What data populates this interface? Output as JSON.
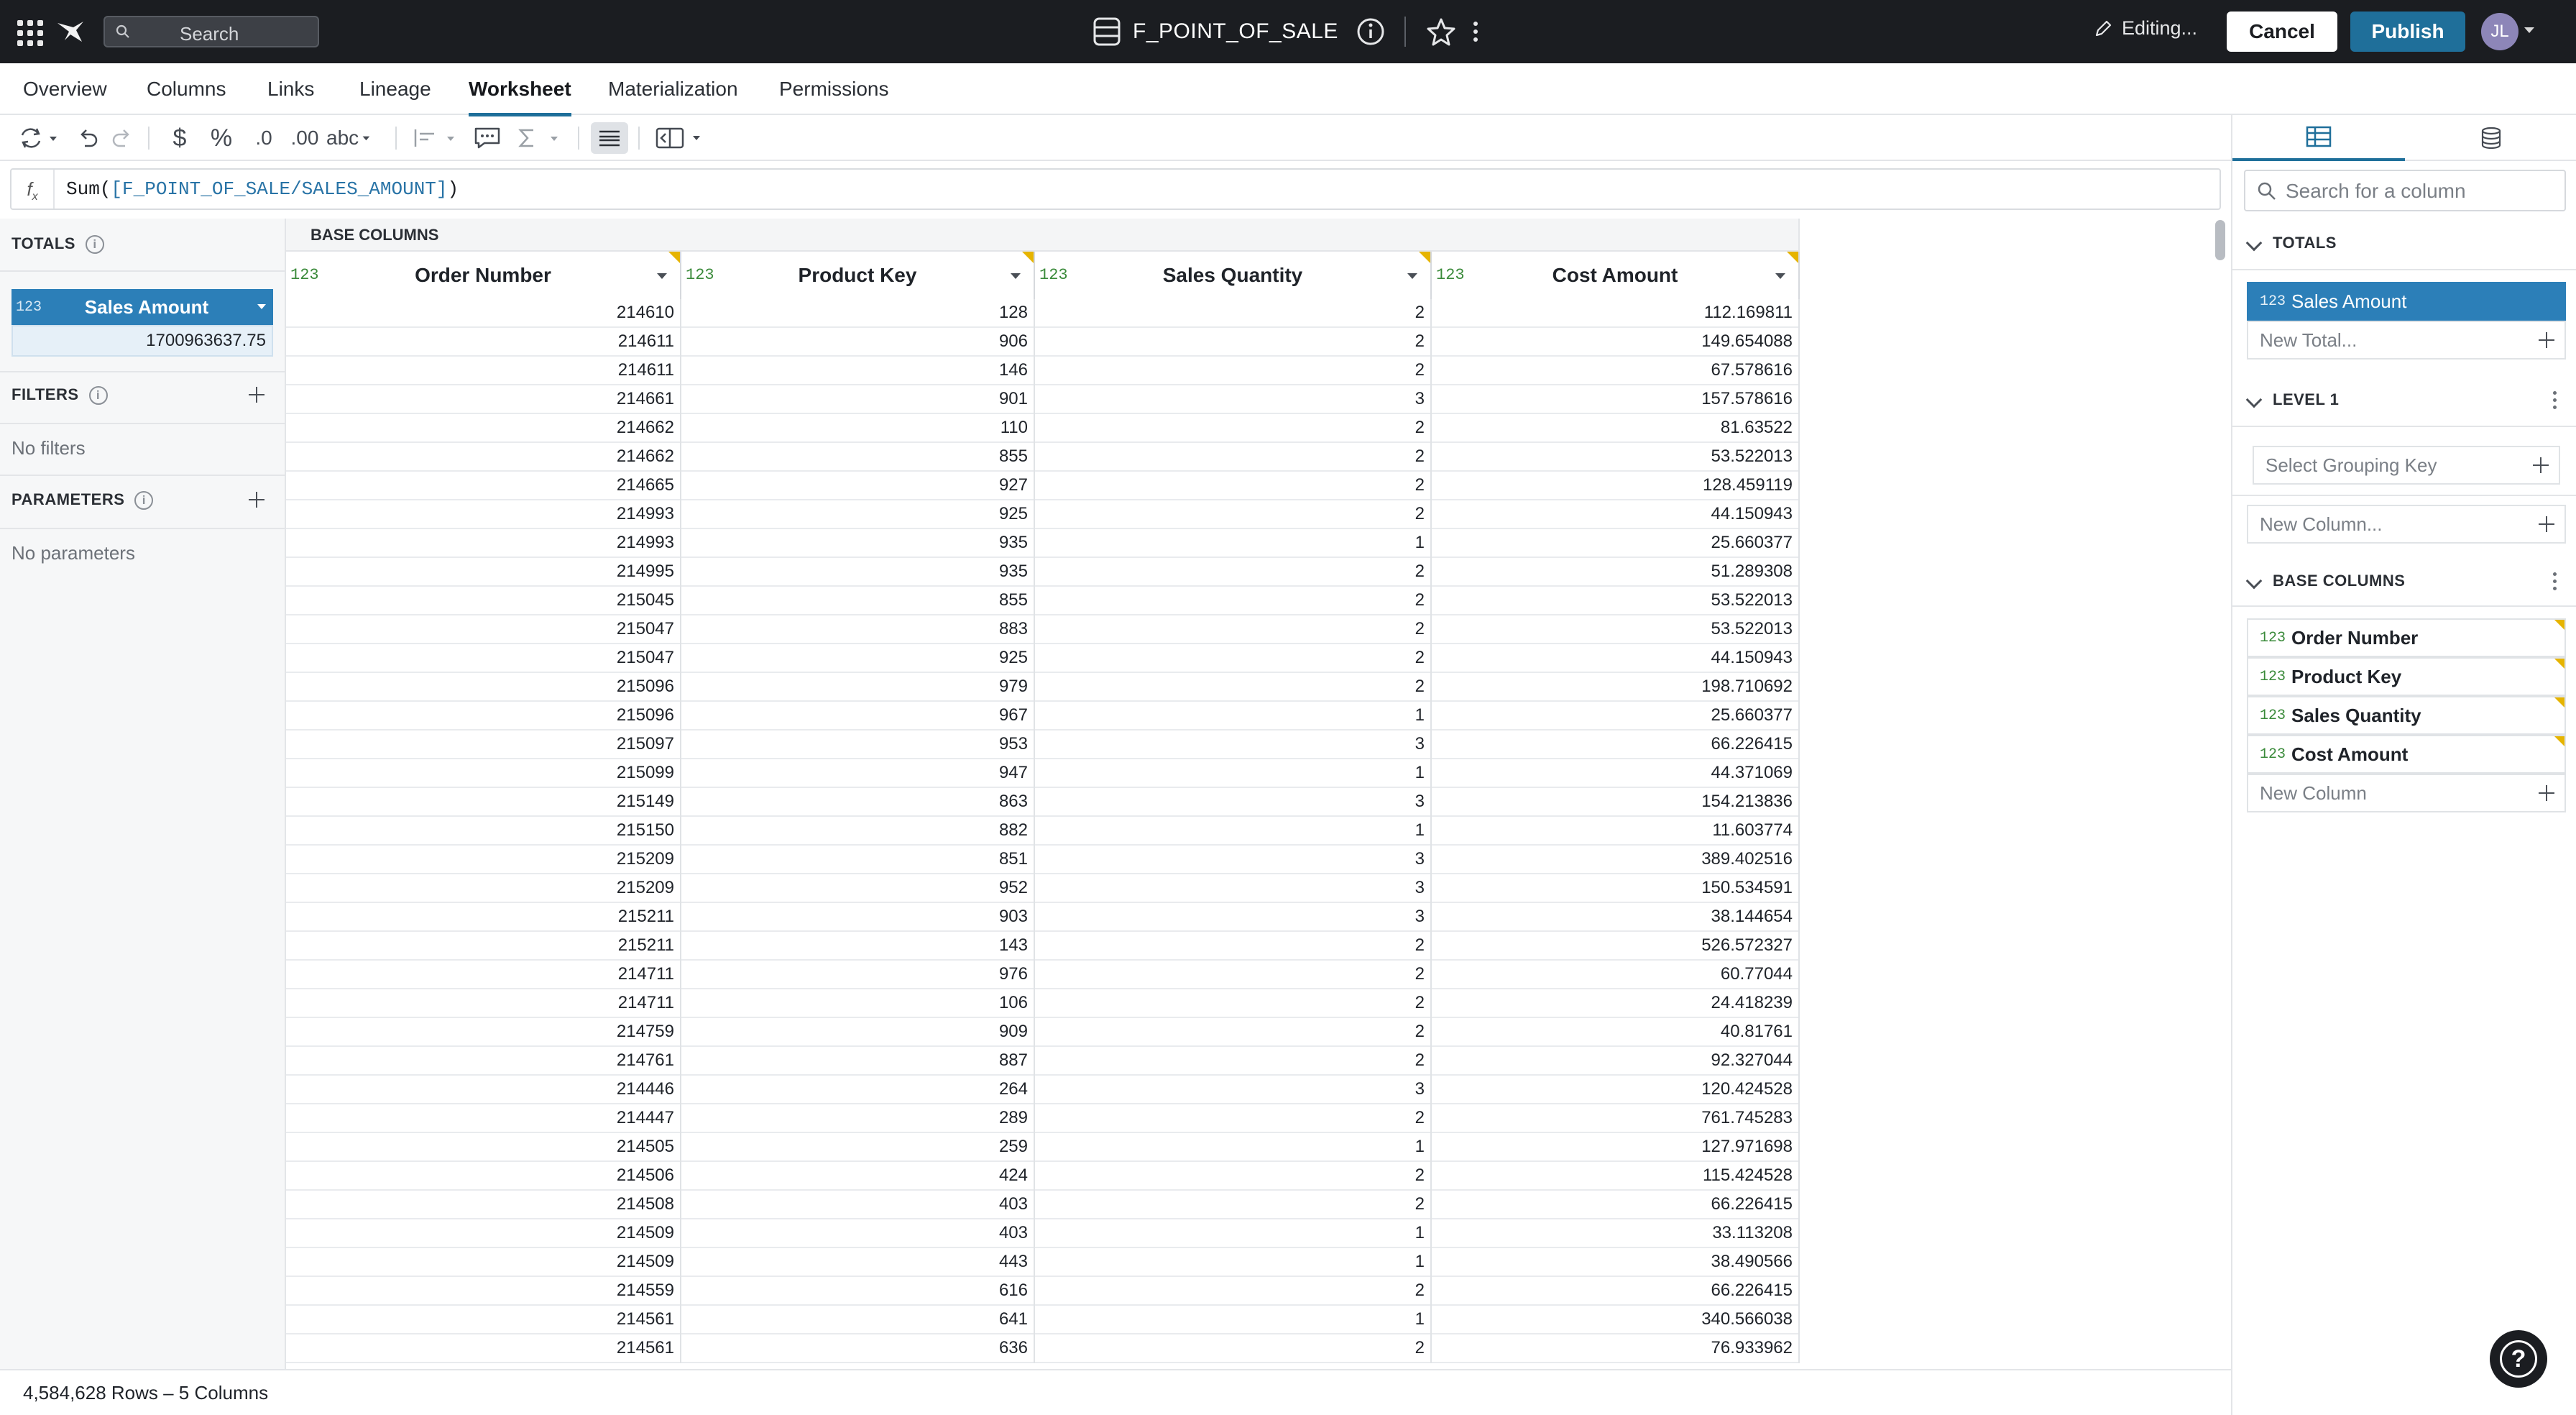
{
  "topbar": {
    "search_placeholder": "Search",
    "title": "F_POINT_OF_SALE",
    "editing_label": "Editing...",
    "cancel_label": "Cancel",
    "publish_label": "Publish",
    "avatar_initials": "JL"
  },
  "tabs": [
    {
      "label": "Overview"
    },
    {
      "label": "Columns"
    },
    {
      "label": "Links"
    },
    {
      "label": "Lineage"
    },
    {
      "label": "Worksheet",
      "active": true
    },
    {
      "label": "Materialization"
    },
    {
      "label": "Permissions"
    }
  ],
  "toolbar": {
    "currency_label": "$",
    "percent_label": "%",
    "decimal_dec_label": ".0",
    "decimal_inc_label": ".00",
    "text_format_label": "abc"
  },
  "formula": {
    "func": "Sum(",
    "ref": "[F_POINT_OF_SALE/SALES_AMOUNT]",
    "close": ")"
  },
  "left": {
    "totals_title": "TOTALS",
    "total_type": "123",
    "total_name": "Sales Amount",
    "total_value": "1700963637.75",
    "filters_title": "FILTERS",
    "filters_empty": "No filters",
    "params_title": "PARAMETERS",
    "params_empty": "No parameters"
  },
  "grid": {
    "group_label": "BASE COLUMNS",
    "columns": [
      {
        "type": "123",
        "name": "Order Number"
      },
      {
        "type": "123",
        "name": "Product Key"
      },
      {
        "type": "123",
        "name": "Sales Quantity"
      },
      {
        "type": "123",
        "name": "Cost Amount"
      }
    ],
    "rows": [
      [
        "214610",
        "128",
        "2",
        "112.169811"
      ],
      [
        "214611",
        "906",
        "2",
        "149.654088"
      ],
      [
        "214611",
        "146",
        "2",
        "67.578616"
      ],
      [
        "214661",
        "901",
        "3",
        "157.578616"
      ],
      [
        "214662",
        "110",
        "2",
        "81.63522"
      ],
      [
        "214662",
        "855",
        "2",
        "53.522013"
      ],
      [
        "214665",
        "927",
        "2",
        "128.459119"
      ],
      [
        "214993",
        "925",
        "2",
        "44.150943"
      ],
      [
        "214993",
        "935",
        "1",
        "25.660377"
      ],
      [
        "214995",
        "935",
        "2",
        "51.289308"
      ],
      [
        "215045",
        "855",
        "2",
        "53.522013"
      ],
      [
        "215047",
        "883",
        "2",
        "53.522013"
      ],
      [
        "215047",
        "925",
        "2",
        "44.150943"
      ],
      [
        "215096",
        "979",
        "2",
        "198.710692"
      ],
      [
        "215096",
        "967",
        "1",
        "25.660377"
      ],
      [
        "215097",
        "953",
        "3",
        "66.226415"
      ],
      [
        "215099",
        "947",
        "1",
        "44.371069"
      ],
      [
        "215149",
        "863",
        "3",
        "154.213836"
      ],
      [
        "215150",
        "882",
        "1",
        "11.603774"
      ],
      [
        "215209",
        "851",
        "3",
        "389.402516"
      ],
      [
        "215209",
        "952",
        "3",
        "150.534591"
      ],
      [
        "215211",
        "903",
        "3",
        "38.144654"
      ],
      [
        "215211",
        "143",
        "2",
        "526.572327"
      ],
      [
        "214711",
        "976",
        "2",
        "60.77044"
      ],
      [
        "214711",
        "106",
        "2",
        "24.418239"
      ],
      [
        "214759",
        "909",
        "2",
        "40.81761"
      ],
      [
        "214761",
        "887",
        "2",
        "92.327044"
      ],
      [
        "214446",
        "264",
        "3",
        "120.424528"
      ],
      [
        "214447",
        "289",
        "2",
        "761.745283"
      ],
      [
        "214505",
        "259",
        "1",
        "127.971698"
      ],
      [
        "214506",
        "424",
        "2",
        "115.424528"
      ],
      [
        "214508",
        "403",
        "2",
        "66.226415"
      ],
      [
        "214509",
        "403",
        "1",
        "33.113208"
      ],
      [
        "214509",
        "443",
        "1",
        "38.490566"
      ],
      [
        "214559",
        "616",
        "2",
        "66.226415"
      ],
      [
        "214561",
        "641",
        "1",
        "340.566038"
      ],
      [
        "214561",
        "636",
        "2",
        "76.933962"
      ]
    ]
  },
  "status": {
    "summary": "4,584,628 Rows – 5 Columns"
  },
  "right": {
    "search_placeholder": "Search for a column",
    "totals_title": "TOTALS",
    "total_item": {
      "type": "123",
      "name": "Sales Amount"
    },
    "new_total": "New Total...",
    "level_title": "LEVEL 1",
    "grouping_placeholder": "Select Grouping Key",
    "new_column_dots": "New Column...",
    "base_title": "BASE COLUMNS",
    "base_items": [
      {
        "type": "123",
        "name": "Order Number"
      },
      {
        "type": "123",
        "name": "Product Key"
      },
      {
        "type": "123",
        "name": "Sales Quantity"
      },
      {
        "type": "123",
        "name": "Cost Amount"
      }
    ],
    "new_column": "New Column"
  },
  "colors": {
    "topbar": "#1b1d21",
    "accent": "#1f6f9a",
    "selected": "#2c7fb8",
    "type_green": "#3a8a3a",
    "flag": "#e6b400"
  },
  "help_label": "?"
}
